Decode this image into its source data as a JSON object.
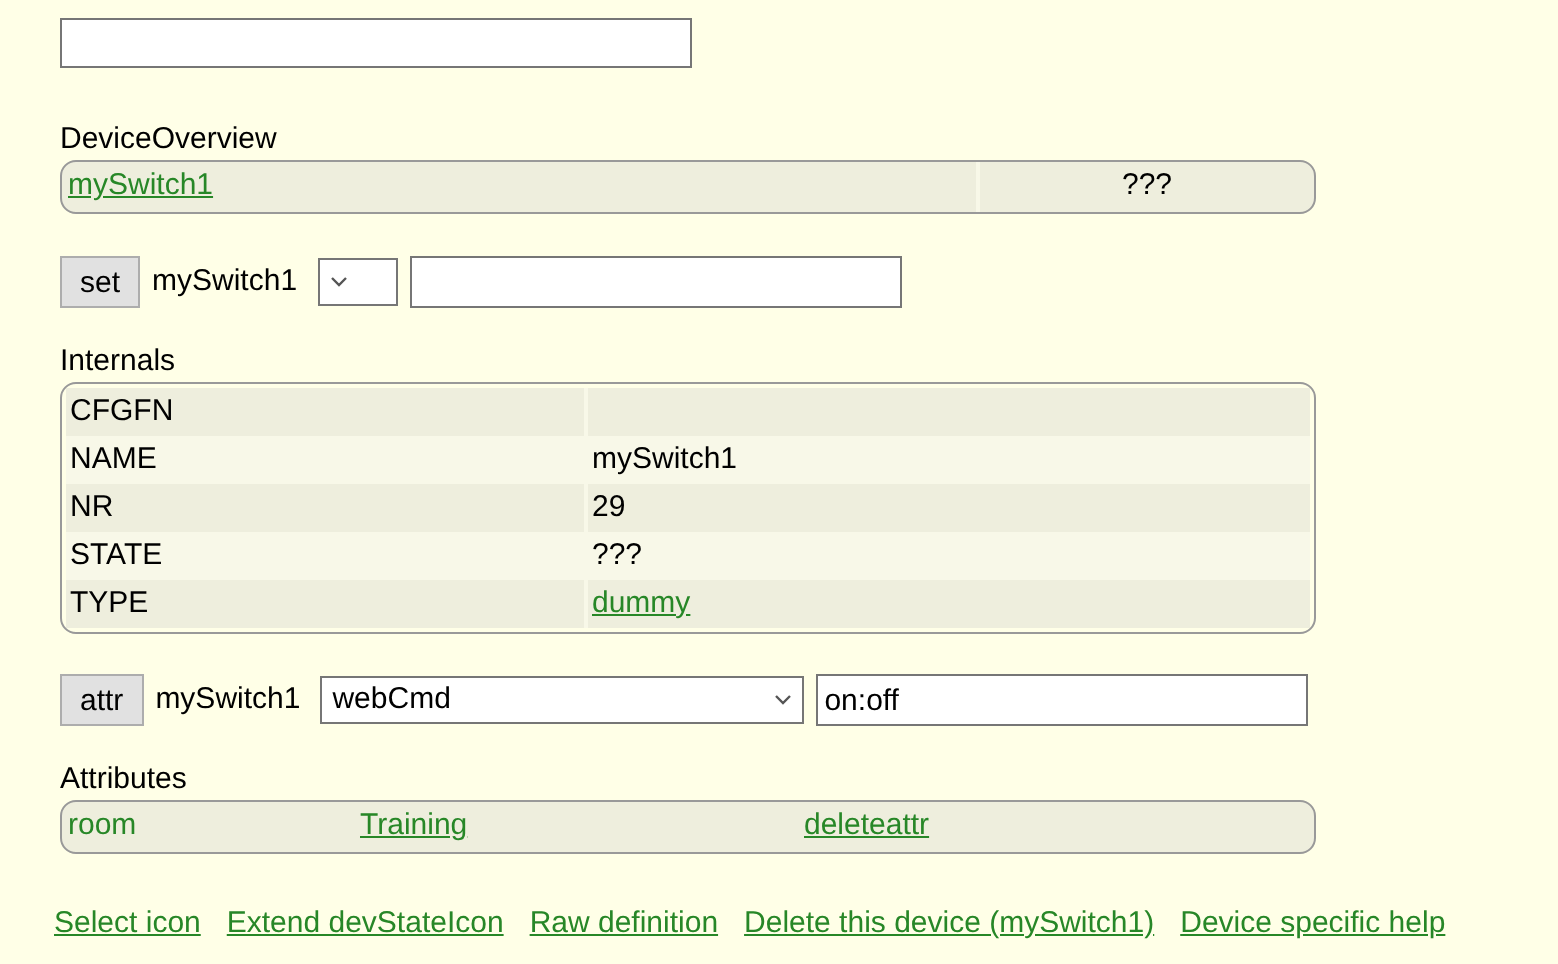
{
  "device_overview": {
    "title": "DeviceOverview",
    "device": "mySwitch1",
    "state": "???"
  },
  "set_command": {
    "button": "set",
    "device": "mySwitch1"
  },
  "internals": {
    "title": "Internals",
    "rows": [
      {
        "name": "CFGFN"
      },
      {
        "name": "NAME",
        "value": "mySwitch1",
        "kind": "text"
      },
      {
        "name": "NR",
        "value": "29",
        "kind": "text"
      },
      {
        "name": "STATE",
        "value": "???",
        "kind": "text"
      },
      {
        "name": "TYPE",
        "value": "dummy",
        "kind": "link"
      }
    ]
  },
  "attr_command": {
    "button": "attr",
    "device": "mySwitch1",
    "option": "webCmd",
    "value": "on:off"
  },
  "attributes": {
    "title": "Attributes",
    "rows": [
      {
        "name": "room",
        "value": "Training",
        "action": "deleteattr"
      }
    ]
  },
  "links": [
    "Select icon",
    "Extend devStateIcon",
    "Raw definition",
    "Delete this device (mySwitch1)",
    "Device specific help"
  ]
}
